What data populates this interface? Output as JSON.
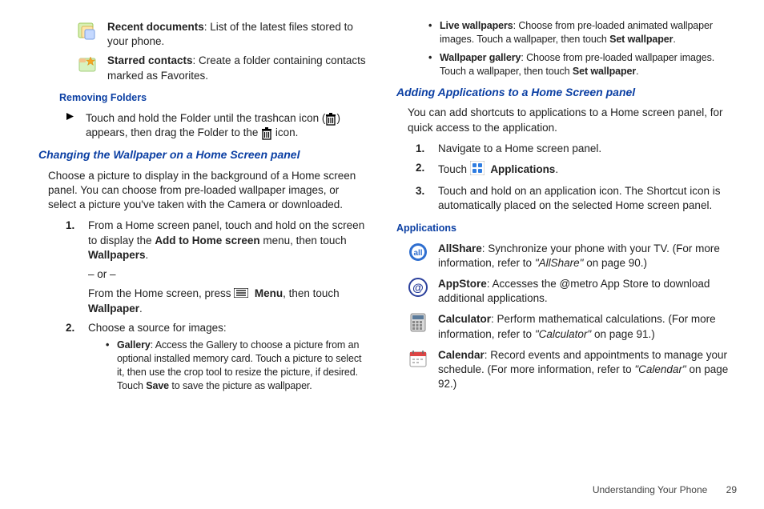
{
  "left": {
    "recent_docs": {
      "label": "Recent documents",
      "desc": ": List of the latest files stored to your phone."
    },
    "starred": {
      "label": "Starred contacts",
      "desc": ": Create a folder containing contacts marked as Favorites."
    },
    "removing_folders_h": "Removing Folders",
    "step_remove_a": "Touch and hold the Folder until the trashcan icon (",
    "step_remove_b": ") appears, then drag the Folder to the ",
    "step_remove_c": " icon.",
    "changing_h": "Changing the Wallpaper on a Home Screen panel",
    "changing_p": "Choose a picture to display in the background of a Home screen panel. You can choose from pre-loaded wallpaper images, or select a picture you've taken with the Camera or downloaded.",
    "ol1_num": "1.",
    "ol1_a": "From a Home screen panel, touch and hold on the screen to display the ",
    "ol1_bold1": "Add to Home screen",
    "ol1_b": " menu, then touch ",
    "ol1_bold2": "Wallpapers",
    "ol1_c": ".",
    "or": "– or –",
    "ol1_d": "From the Home screen, press ",
    "ol1_menu": "Menu",
    "ol1_e": ", then touch ",
    "ol1_bold3": "Wallpaper",
    "ol1_f": ".",
    "ol2_num": "2.",
    "ol2_a": "Choose a source for images:",
    "ul_gallery_label": "Gallery",
    "ul_gallery_txt": ": Access the Gallery to choose a picture from an optional installed memory card. Touch a picture to select it, then use the crop tool to resize the picture, if desired. Touch ",
    "ul_gallery_save": "Save",
    "ul_gallery_end": " to save the picture as wallpaper."
  },
  "right": {
    "live_label": "Live wallpapers",
    "live_txt": ": Choose from pre-loaded animated wallpaper images. Touch a wallpaper, then touch ",
    "live_bold": "Set wallpaper",
    "live_end": ".",
    "wg_label": "Wallpaper gallery",
    "wg_txt": ": Choose from pre-loaded wallpaper images. Touch a wallpaper, then touch ",
    "wg_bold": "Set wallpaper",
    "wg_end": ".",
    "adding_h": "Adding Applications to a Home Screen panel",
    "adding_p": "You can add shortcuts to applications to a Home screen panel, for quick access to the application.",
    "ol1_num": "1.",
    "ol1_txt": "Navigate to a Home screen panel.",
    "ol2_num": "2.",
    "ol2_a": "Touch ",
    "ol2_apps": "Applications",
    "ol2_b": ".",
    "ol3_num": "3.",
    "ol3_txt": "Touch and hold on an application icon. The Shortcut icon is automatically placed on the selected Home screen panel.",
    "applications_h": "Applications",
    "allshare_label": "AllShare",
    "allshare_txt": ": Synchronize your phone with your TV. (For more information, refer to ",
    "allshare_ref": "\"AllShare\"",
    "allshare_end": " on page 90.)",
    "appstore_label": "AppStore",
    "appstore_txt": ": Accesses the @metro App Store to download additional applications.",
    "calc_label": "Calculator",
    "calc_txt": ": Perform mathematical calculations. (For more information, refer to ",
    "calc_ref": "\"Calculator\"",
    "calc_end": " on page 91.)",
    "cal_label": "Calendar",
    "cal_txt": ": Record events and appointments to manage your schedule. (For more information, refer to ",
    "cal_ref": "\"Calendar\"",
    "cal_end": " on page 92.)"
  },
  "footer": {
    "section": "Understanding Your Phone",
    "page": "29"
  }
}
